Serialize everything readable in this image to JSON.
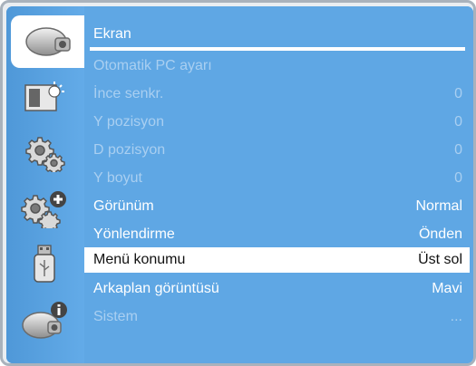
{
  "sidebar": {
    "tabs": [
      {
        "name": "projector-display-icon",
        "active": true
      },
      {
        "name": "picture-adjust-icon",
        "active": false
      },
      {
        "name": "setup-gear-icon",
        "active": false
      },
      {
        "name": "advanced-setup-gear-icon",
        "active": false
      },
      {
        "name": "usb-icon",
        "active": false
      },
      {
        "name": "projector-info-icon",
        "active": false
      }
    ]
  },
  "menu": {
    "title": "Ekran",
    "items": [
      {
        "label": "Otomatik PC ayarı",
        "value": "",
        "state": "disabled"
      },
      {
        "label": "İnce senkr.",
        "value": "0",
        "state": "disabled"
      },
      {
        "label": "Y pozisyon",
        "value": "0",
        "state": "disabled"
      },
      {
        "label": "D pozisyon",
        "value": "0",
        "state": "disabled"
      },
      {
        "label": "Y boyut",
        "value": "0",
        "state": "disabled"
      },
      {
        "label": "Görünüm",
        "value": "Normal",
        "state": "enabled"
      },
      {
        "label": "Yönlendirme",
        "value": "Önden",
        "state": "enabled"
      },
      {
        "label": "Menü konumu",
        "value": "Üst sol",
        "state": "selected"
      },
      {
        "label": "Arkaplan görüntüsü",
        "value": "Mavi",
        "state": "enabled"
      },
      {
        "label": "Sistem",
        "value": "...",
        "state": "disabled"
      }
    ]
  },
  "colors": {
    "panel": "#5fa7e4",
    "disabled_text": "#a9cff1",
    "selected_bg": "#ffffff"
  }
}
